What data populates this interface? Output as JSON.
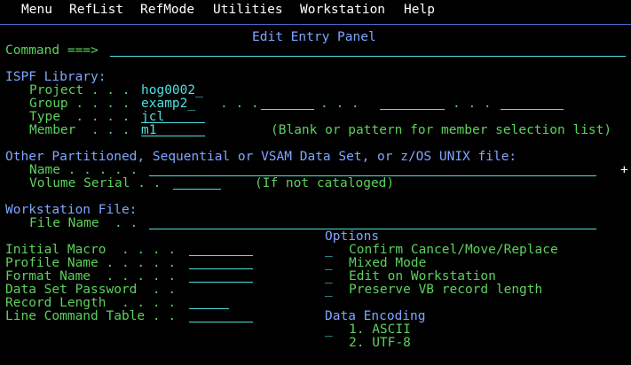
{
  "menu": {
    "items": [
      {
        "label": "Menu"
      },
      {
        "label": "RefList"
      },
      {
        "label": "RefMode"
      },
      {
        "label": "Utilities"
      },
      {
        "label": "Workstation"
      },
      {
        "label": "Help"
      }
    ]
  },
  "panel": {
    "title": "Edit Entry Panel",
    "command_label": "Command ===>",
    "command_value": ""
  },
  "ispf": {
    "heading": "ISPF Library:",
    "project_label": "Project . . .",
    "project_value": "hog0002_",
    "group_label": "Group . . . .",
    "group_value": "examp2_",
    "group_dots1": ". . .",
    "group_dots2": ". . .",
    "group_dots3": ". . .",
    "type_label": "Type  . . . .",
    "type_value": "jcl",
    "member_label": "Member  . . .",
    "member_value": "m1",
    "member_hint": "(Blank or pattern for member selection list)"
  },
  "other": {
    "heading": "Other Partitioned, Sequential or VSAM Data Set, or z/OS UNIX file:",
    "name_label": "Name . . . . .",
    "more_marker": "+",
    "volume_label": "Volume Serial . .",
    "volume_hint": "(If not cataloged)"
  },
  "workstation": {
    "heading": "Workstation File:",
    "file_label": "File Name  . ."
  },
  "left_fields": {
    "initial_macro": "Initial Macro  . . . .",
    "profile_name": "Profile Name . . . . .",
    "format_name": "Format Name  . . . . .",
    "dataset_password": "Data Set Password  . .",
    "record_length": "Record Length  . . . .",
    "line_command_table": "Line Command Table . ."
  },
  "options": {
    "heading": "Options",
    "items": [
      {
        "mark": "_",
        "label": "Confirm Cancel/Move/Replace"
      },
      {
        "mark": "_",
        "label": "Mixed Mode"
      },
      {
        "mark": "_",
        "label": "Edit on Workstation"
      },
      {
        "mark": "_",
        "label": "Preserve VB record length"
      }
    ]
  },
  "encoding": {
    "heading": "Data Encoding",
    "mark": "_",
    "items": [
      {
        "label": "1. ASCII"
      },
      {
        "label": "2. UTF-8"
      }
    ]
  },
  "colors": {
    "background": "#000000",
    "green": "#5dd15d",
    "cyan": "#4fe0e0",
    "blue": "#7fa6ff",
    "white": "#ffffff",
    "separator": "#4a6bd8"
  }
}
